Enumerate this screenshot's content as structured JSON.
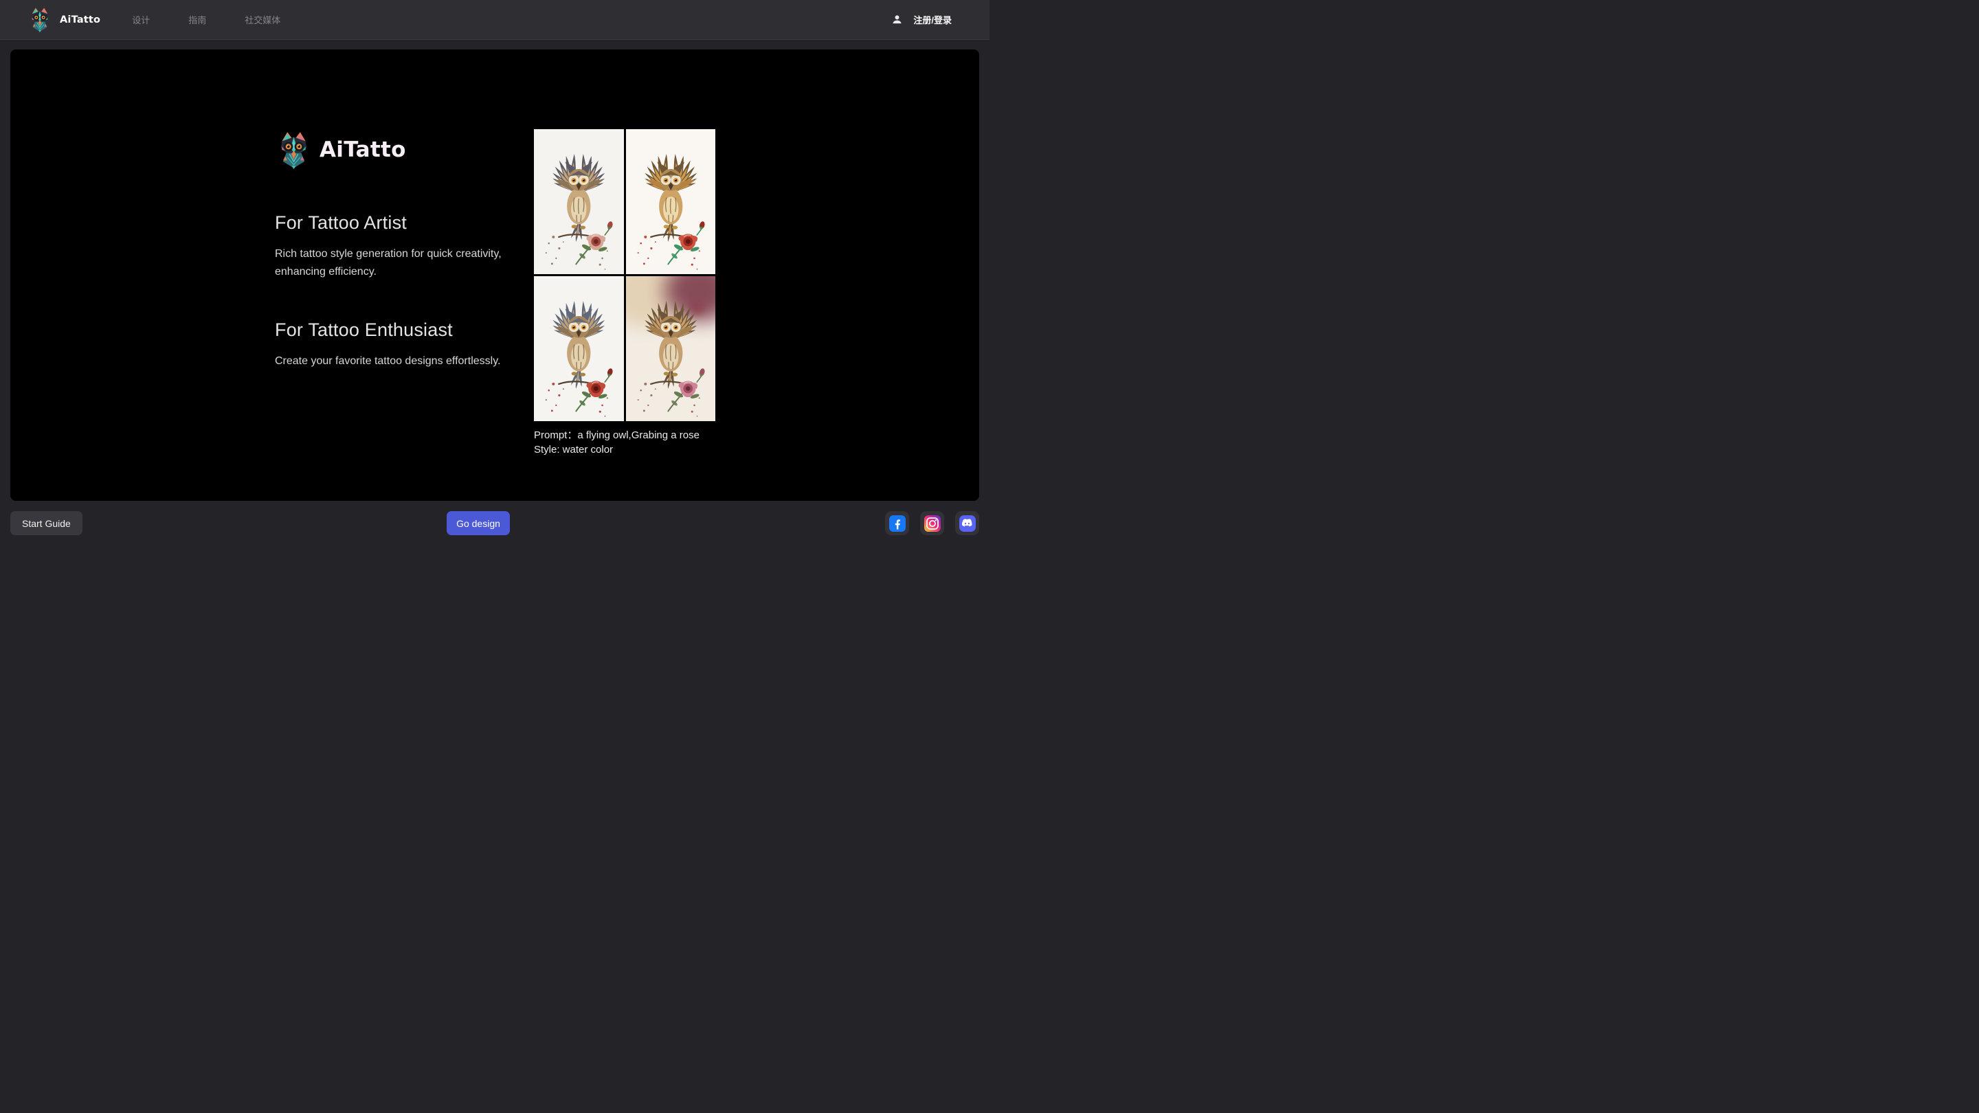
{
  "navbar": {
    "brand": "AiTatto",
    "items": [
      {
        "label": "设计"
      },
      {
        "label": "指南"
      },
      {
        "label": "社交媒体"
      }
    ],
    "auth_label": "注册/登录"
  },
  "hero": {
    "brand": "AiTatto",
    "sections": [
      {
        "title": "For Tattoo Artist",
        "description": "Rich tattoo style generation for quick creativity, enhancing efficiency."
      },
      {
        "title": "For Tattoo Enthusiast",
        "description": "Create your favorite tattoo designs effortlessly."
      }
    ],
    "showcase": {
      "prompt_line": "Prompt：a flying owl,Grabing a rose",
      "style_line": "Style: water color",
      "images": [
        {
          "alt": "Watercolor flying owl grabbing a pale rose"
        },
        {
          "alt": "Watercolor flying owl with red rose and red paint splatters"
        },
        {
          "alt": "Watercolor flying owl with two red roses"
        },
        {
          "alt": "Watercolor flying owl with pink rose on beige and maroon wash"
        }
      ]
    }
  },
  "footer": {
    "start_guide_label": "Start Guide",
    "go_design_label": "Go design",
    "social": [
      {
        "name": "Facebook"
      },
      {
        "name": "Instagram"
      },
      {
        "name": "Discord"
      }
    ]
  },
  "colors": {
    "accent": "#4c59d6",
    "facebook": "#1877f2",
    "discord": "#5865f2",
    "instagram_gradient": "#f9ce34 / #ee2a7b / #6228d7",
    "navbar_bg": "#2e2e33",
    "page_bg": "#232328",
    "panel_bg": "#000000"
  }
}
